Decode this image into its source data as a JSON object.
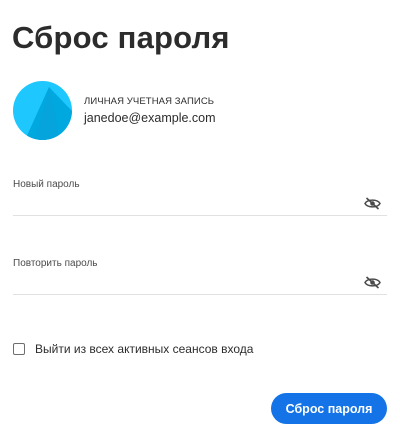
{
  "page": {
    "title": "Сброс пароля"
  },
  "account": {
    "label": "ЛИЧНАЯ УЧЕТНАЯ ЗАПИСЬ",
    "email": "janedoe@example.com",
    "avatar_icon": "avatar-icon",
    "avatar_colors": {
      "light": "#1ec8ff",
      "dark": "#00a8e0"
    }
  },
  "fields": {
    "new_password": {
      "label": "Новый пароль",
      "value": "",
      "toggle_icon": "eye-slash-icon"
    },
    "confirm_password": {
      "label": "Повторить пароль",
      "value": "",
      "toggle_icon": "eye-slash-icon"
    }
  },
  "signout": {
    "label": "Выйти из всех активных сеансов входа",
    "checked": false
  },
  "submit": {
    "label": "Сброс пароля",
    "color": "#1473e6"
  }
}
